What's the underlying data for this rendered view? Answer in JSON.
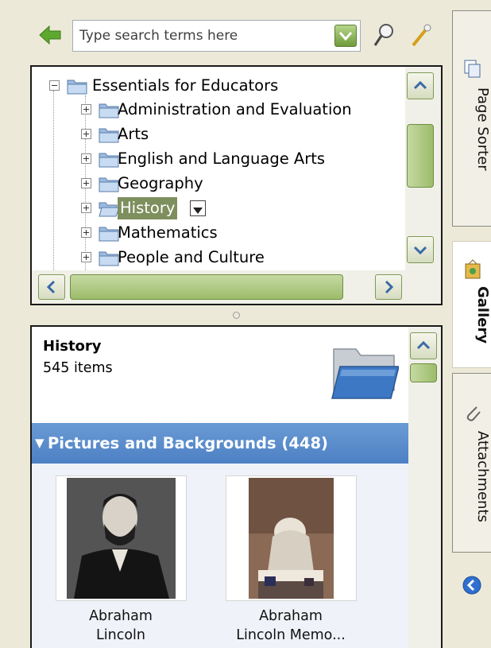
{
  "search": {
    "placeholder": "Type search terms here"
  },
  "tree": {
    "root": "Essentials for Educators",
    "items": [
      {
        "label": "Administration and Evaluation"
      },
      {
        "label": "Arts"
      },
      {
        "label": "English and Language Arts"
      },
      {
        "label": "Geography"
      },
      {
        "label": "History",
        "selected": true
      },
      {
        "label": "Mathematics"
      },
      {
        "label": "People and Culture"
      }
    ]
  },
  "gallery": {
    "title": "History",
    "count": "545 items",
    "section_title": "Pictures and Backgrounds (448)",
    "thumbnails": [
      {
        "line1": "Abraham",
        "line2": "Lincoln"
      },
      {
        "line1": "Abraham",
        "line2": "Lincoln Memo..."
      }
    ]
  },
  "tabs": {
    "page_sorter": "Page Sorter",
    "gallery": "Gallery",
    "attachments": "Attachments"
  },
  "colors": {
    "accent_green": "#6f9a3b",
    "section_blue": "#5a8bcc",
    "selected_bg": "#7e8f5e",
    "window_bg": "#ece9d8"
  },
  "icons": [
    "back-arrow-icon",
    "search-icon",
    "wand-icon",
    "folder-icon",
    "page-sorter-icon",
    "gallery-icon",
    "paperclip-icon",
    "collapse-arrow-icon"
  ]
}
